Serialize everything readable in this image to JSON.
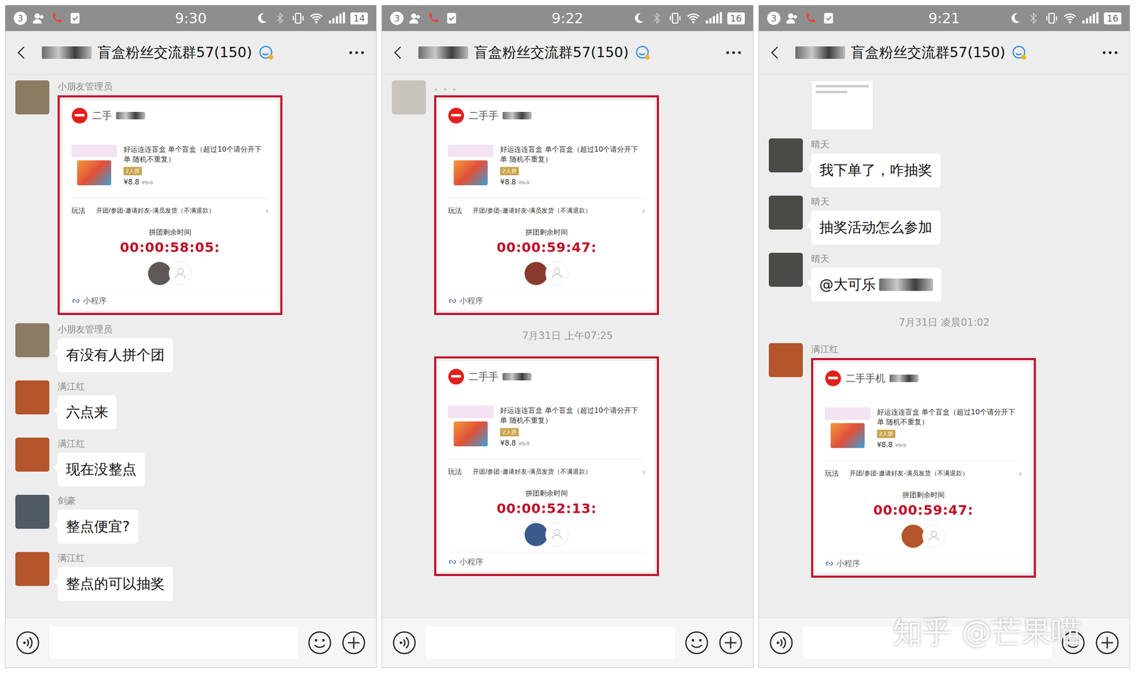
{
  "panels": [
    {
      "status": {
        "badge": "3",
        "time": "9:30",
        "battery": "14"
      },
      "title": {
        "text": "盲盒粉丝交流群57(150)",
        "redacted": true
      },
      "messages": [
        {
          "kind": "card",
          "sender": "小朋友管理员",
          "avatar_color": "#8b7b62",
          "highlighted": true,
          "card": {
            "merchant": "二手",
            "merchant_redacted": true,
            "product_title": "好运连连盲盒 单个盲盒（超过10个请分开下单 随机不重复）",
            "badge": "2人拼",
            "price": "¥8.8",
            "original_price": "¥9.9",
            "rule_label": "玩法",
            "rule": "开团/参团-邀请好友-满员发货（不满退款）",
            "chevron": "›",
            "timer_label": "拼团剩余时间",
            "timer": "00:00:58:05:",
            "participants": [
              {
                "filled": true,
                "color": "#5d5a55"
              },
              {
                "filled": false,
                "color": "#ffffff"
              }
            ],
            "footer": "小程序"
          }
        },
        {
          "kind": "text",
          "sender": "小朋友管理员",
          "avatar_color": "#8b7b62",
          "text": "有没有人拼个团",
          "redacted": false
        },
        {
          "kind": "text",
          "sender": "满江红",
          "avatar_color": "#b4552c",
          "text": "六点来",
          "redacted": false
        },
        {
          "kind": "text",
          "sender": "满江红",
          "avatar_color": "#b4552c",
          "text": "现在没整点",
          "redacted": false
        },
        {
          "kind": "text",
          "sender": "剑豪",
          "avatar_color": "#4f5a66",
          "text": "整点便宜?",
          "redacted": false
        },
        {
          "kind": "text",
          "sender": "满江红",
          "avatar_color": "#b4552c",
          "text": "整点的可以抽奖",
          "redacted": false
        }
      ]
    },
    {
      "status": {
        "badge": "3",
        "time": "9:22",
        "battery": "16"
      },
      "title": {
        "text": "盲盒粉丝交流群57(150)",
        "redacted": true
      },
      "messages": [
        {
          "kind": "card",
          "sender": "。。。",
          "avatar_color": "#c9c3bd",
          "highlighted": true,
          "card": {
            "merchant": "二手手",
            "merchant_redacted": true,
            "product_title": "好运连连盲盒 单个盲盒（超过10个请分开下单 随机不重复）",
            "badge": "2人拼",
            "price": "¥8.8",
            "original_price": "¥9.9",
            "rule_label": "玩法",
            "rule": "开团/参团-邀请好友-满员发货（不满退款）",
            "chevron": "›",
            "timer_label": "拼团剩余时间",
            "timer": "00:00:59:47:",
            "participants": [
              {
                "filled": true,
                "color": "#8a3a2c"
              },
              {
                "filled": false,
                "color": "#ffffff"
              }
            ],
            "footer": "小程序"
          }
        },
        {
          "kind": "timestamp",
          "text": "7月31日 上午07:25"
        },
        {
          "kind": "card",
          "sender": null,
          "avatar_color": "#ededed",
          "highlighted": true,
          "card": {
            "merchant": "二手手",
            "merchant_redacted": true,
            "product_title": "好运连连盲盒 单个盲盒（超过10个请分开下单 随机不重复）",
            "badge": "2人拼",
            "price": "¥8.8",
            "original_price": "¥9.9",
            "rule_label": "玩法",
            "rule": "开团/参团-邀请好友-满员发货（不满退款）",
            "chevron": "›",
            "timer_label": "拼团剩余时间",
            "timer": "00:00:52:13:",
            "participants": [
              {
                "filled": true,
                "color": "#3b5a8c"
              },
              {
                "filled": false,
                "color": "#ffffff"
              }
            ],
            "footer": "小程序"
          }
        }
      ]
    },
    {
      "status": {
        "badge": "3",
        "time": "9:21",
        "battery": "16"
      },
      "title": {
        "text": "盲盒粉丝交流群57(150)",
        "redacted": true
      },
      "messages": [
        {
          "kind": "image",
          "sender": null,
          "avatar_color": "#ededed"
        },
        {
          "kind": "text",
          "sender": "晴天",
          "avatar_color": "#4a4a46",
          "text": "我下单了，咋抽奖",
          "redacted": false
        },
        {
          "kind": "text",
          "sender": "晴天",
          "avatar_color": "#4a4a46",
          "text": "抽奖活动怎么参加",
          "redacted": false
        },
        {
          "kind": "text",
          "sender": "晴天",
          "avatar_color": "#4a4a46",
          "text": "@大可乐",
          "redacted": true
        },
        {
          "kind": "timestamp",
          "text": "7月31日 凌晨01:02"
        },
        {
          "kind": "card",
          "sender": "满江红",
          "avatar_color": "#b4552c",
          "highlighted": true,
          "card": {
            "merchant": "二手手机",
            "merchant_redacted": true,
            "product_title": "好运连连盲盒 单个盲盒（超过10个请分开下单 随机不重复）",
            "badge": "2人拼",
            "price": "¥8.8",
            "original_price": "¥9.9",
            "rule_label": "玩法",
            "rule": "开团/参团-邀请好友-满员发货（不满退款）",
            "chevron": "›",
            "timer_label": "拼团剩余时间",
            "timer": "00:00:59:47:",
            "participants": [
              {
                "filled": true,
                "color": "#b4552c"
              },
              {
                "filled": false,
                "color": "#ffffff"
              }
            ],
            "footer": "小程序"
          }
        }
      ]
    }
  ],
  "watermark": "知乎 @芒果喵"
}
